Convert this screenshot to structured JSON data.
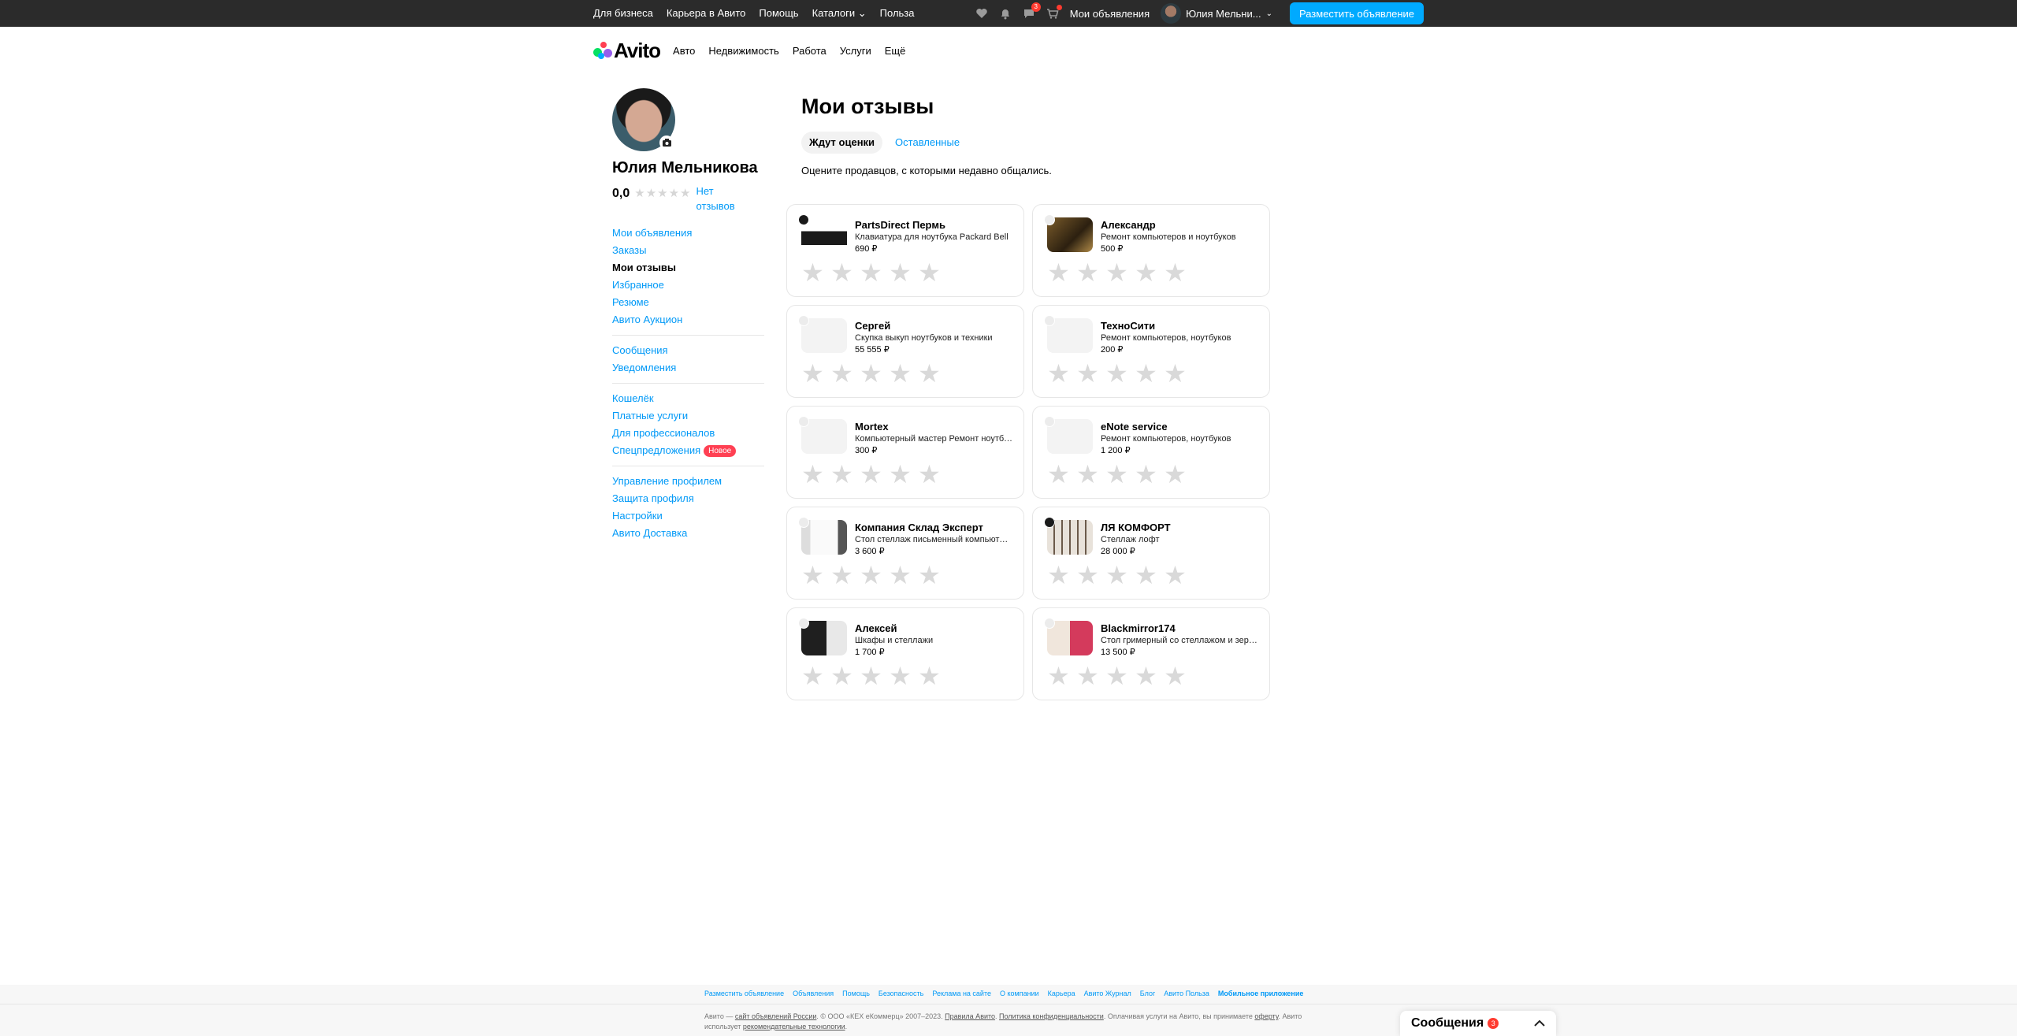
{
  "topbar": {
    "nav": [
      "Для бизнеса",
      "Карьера в Авито",
      "Помощь",
      "Каталоги",
      "Польза"
    ],
    "catalog_chevron": "⌄",
    "messages_badge": "3",
    "my_ads": "Мои объявления",
    "user_name": "Юлия Мельни...",
    "post_button": "Разместить объявление"
  },
  "header": {
    "logo": "Avito",
    "categories": [
      "Авто",
      "Недвижимость",
      "Работа",
      "Услуги",
      "Ещё"
    ]
  },
  "profile": {
    "name": "Юлия Мельникова",
    "rating": "0,0",
    "no_reviews": "Нет отзывов"
  },
  "menu": {
    "group1": [
      "Мои объявления",
      "Заказы",
      "Мои отзывы",
      "Избранное",
      "Резюме",
      "Авито Аукцион"
    ],
    "group2": [
      "Сообщения",
      "Уведомления"
    ],
    "group3": [
      "Кошелёк",
      "Платные услуги",
      "Для профессионалов",
      "Спецпредложения"
    ],
    "new_badge": "Новое",
    "group4": [
      "Управление профилем",
      "Защита профиля",
      "Настройки",
      "Авито Доставка"
    ]
  },
  "main": {
    "title": "Мои отзывы",
    "tab_active": "Ждут оценки",
    "tab_inactive": "Оставленные",
    "hint": "Оцените продавцов, с которыми недавно общались."
  },
  "cards": [
    {
      "seller": "PartsDirect Пермь",
      "desc": "Клавиатура для ноутбука Packard Bell",
      "price": "690 ₽"
    },
    {
      "seller": "Александр",
      "desc": "Ремонт компьютеров и ноутбуков",
      "price": "500 ₽"
    },
    {
      "seller": "Сергей",
      "desc": "Скупка выкуп ноутбуков и техники",
      "price": "55 555 ₽"
    },
    {
      "seller": "ТехноСити",
      "desc": "Ремонт компьютеров, ноутбуков",
      "price": "200 ₽"
    },
    {
      "seller": "Mortex",
      "desc": "Компьютерный мастер Ремонт ноутбуков",
      "price": "300 ₽"
    },
    {
      "seller": "eNote service",
      "desc": "Ремонт компьютеров, ноутбуков",
      "price": "1 200 ₽"
    },
    {
      "seller": "Компания Склад Эксперт",
      "desc": "Стол стеллаж письменный компьютерный",
      "price": "3 600 ₽"
    },
    {
      "seller": "ЛЯ КОМФОРТ",
      "desc": "Стеллаж лофт",
      "price": "28 000 ₽"
    },
    {
      "seller": "Алексей",
      "desc": "Шкафы и стеллажи",
      "price": "1 700 ₽"
    },
    {
      "seller": "Blackmirror174",
      "desc": "Стол гримерный со стеллажом и зеркалом",
      "price": "13 500 ₽"
    }
  ],
  "footer": {
    "links": [
      "Разместить объявление",
      "Объявления",
      "Помощь",
      "Безопасность",
      "Реклама на сайте",
      "О компании",
      "Карьера",
      "Авито Журнал",
      "Блог",
      "Авито Польза",
      "Мобильное приложение"
    ],
    "copy_a": "Авито — ",
    "copy_site": "сайт объявлений России",
    "copy_b": ". © ООО «КЕХ еКоммерц» 2007–2023. ",
    "copy_rules": "Правила Авито",
    "copy_c": ". ",
    "copy_policy": "Политика конфиденциальности",
    "copy_d": ". Оплачивая услуги на Авито, вы принимаете ",
    "copy_offer": "оферту",
    "copy_e": ". Авито использует ",
    "copy_tech": "рекомендательные технологии",
    "copy_f": "."
  },
  "messages_bar": {
    "label": "Сообщения",
    "badge": "3",
    "chevron": "⌃"
  },
  "icons": {
    "favorites": "heart-icon",
    "notifications": "bell-icon",
    "messages": "chat-icon",
    "cart": "cart-icon",
    "camera": "camera-icon"
  },
  "colors": {
    "accent": "#00aaff",
    "link": "#0099f7",
    "topbar": "#2b2b2b",
    "badge": "#ff3b30"
  }
}
